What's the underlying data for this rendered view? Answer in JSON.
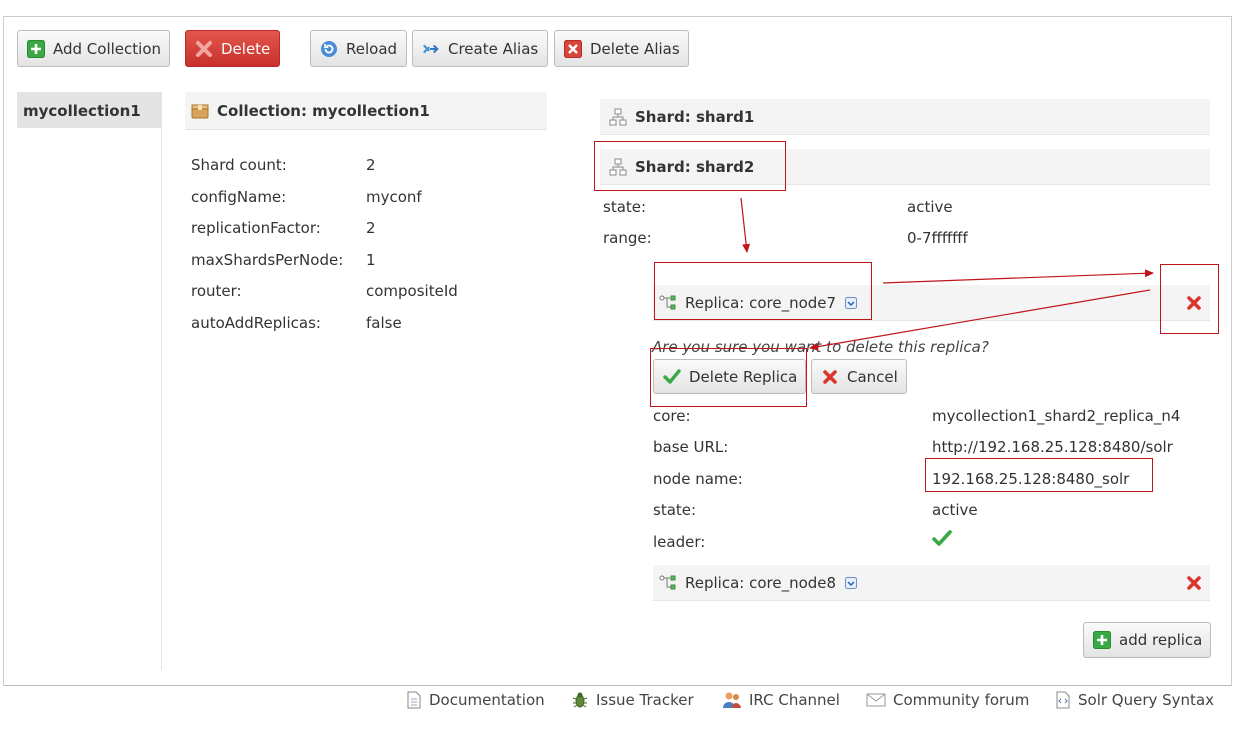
{
  "toolbar": {
    "add_collection": "Add Collection",
    "delete": "Delete",
    "reload": "Reload",
    "create_alias": "Create Alias",
    "delete_alias": "Delete Alias"
  },
  "sidebar": {
    "items": [
      {
        "label": "mycollection1"
      }
    ]
  },
  "collection": {
    "title": "Collection: mycollection1",
    "properties": [
      {
        "key": "Shard count:",
        "value": "2"
      },
      {
        "key": "configName:",
        "value": "myconf"
      },
      {
        "key": "replicationFactor:",
        "value": "2"
      },
      {
        "key": "maxShardsPerNode:",
        "value": "1"
      },
      {
        "key": "router:",
        "value": "compositeId"
      },
      {
        "key": "autoAddReplicas:",
        "value": "false"
      }
    ]
  },
  "shards": [
    {
      "title": "Shard: shard1"
    },
    {
      "title": "Shard: shard2",
      "properties": [
        {
          "key": "state:",
          "value": "active"
        },
        {
          "key": "range:",
          "value": "0-7fffffff"
        }
      ]
    }
  ],
  "replicas": [
    {
      "title": "Replica: core_node7",
      "confirm_text": "Are you sure you want to delete this replica?",
      "delete_replica_label": "Delete Replica",
      "cancel_label": "Cancel",
      "properties": [
        {
          "key": "core:",
          "value": "mycollection1_shard2_replica_n4"
        },
        {
          "key": "base URL:",
          "value": "http://192.168.25.128:8480/solr"
        },
        {
          "key": "node name:",
          "value": "192.168.25.128:8480_solr"
        },
        {
          "key": "state:",
          "value": "active"
        },
        {
          "key": "leader:",
          "value": ""
        }
      ]
    },
    {
      "title": "Replica: core_node8"
    }
  ],
  "add_replica_label": "add replica",
  "footer": {
    "documentation": "Documentation",
    "issue_tracker": "Issue Tracker",
    "irc_channel": "IRC Channel",
    "community_forum": "Community forum",
    "query_syntax": "Solr Query Syntax"
  },
  "colors": {
    "delete_red": "#d9453c",
    "annotation_red": "#c0141b",
    "check_green": "#3aa845",
    "panel_gray": "#f4f4f4"
  }
}
